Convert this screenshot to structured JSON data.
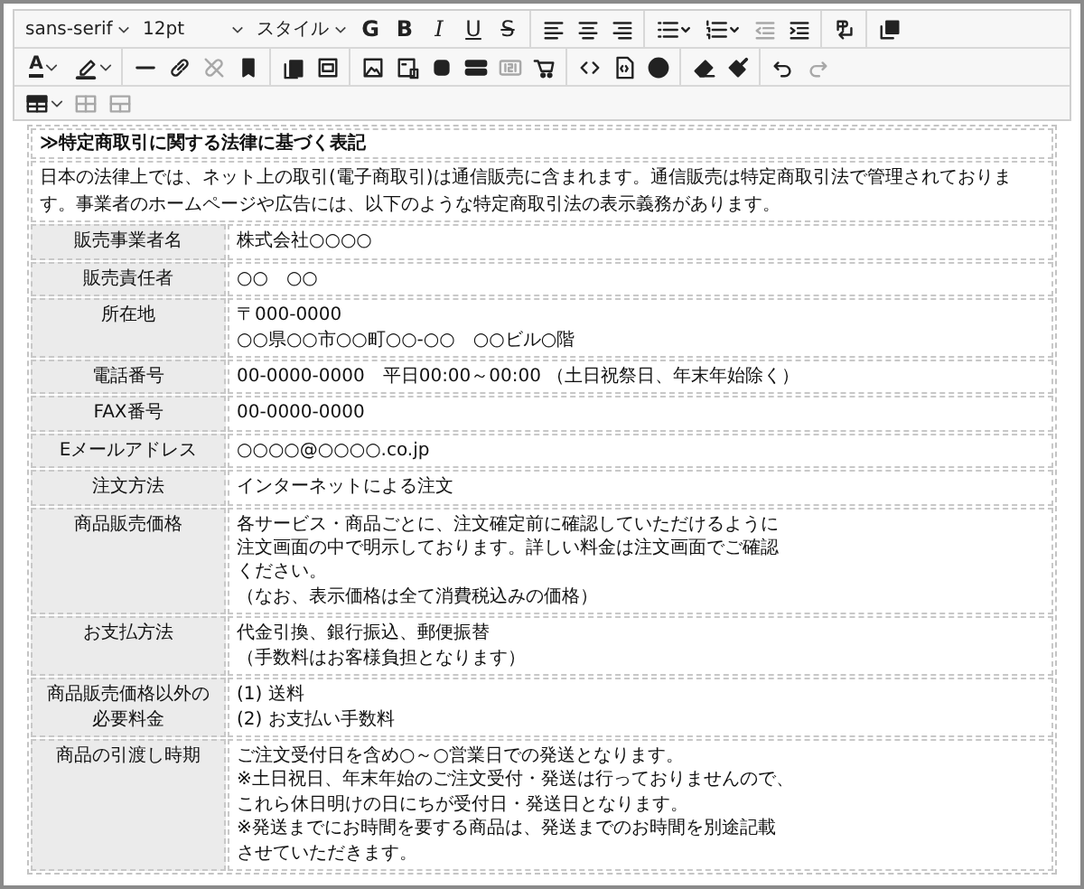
{
  "toolbar": {
    "font": "sans-serif",
    "size": "12pt",
    "style": "スタイル",
    "format_buttons": [
      {
        "label": "G",
        "kind": "plain"
      },
      {
        "label": "B",
        "kind": "bold"
      },
      {
        "label": "I",
        "kind": "italic"
      },
      {
        "label": "U",
        "kind": "underline"
      },
      {
        "label": "S",
        "kind": "strike"
      }
    ],
    "text_color_label": "A",
    "undo": {
      "disabled": false
    },
    "redo": {
      "disabled": true
    },
    "table_buttons": [
      {
        "disabled": true
      },
      {
        "disabled": true
      }
    ]
  },
  "document": {
    "title": "≫特定商取引に関する法律に基づく表記",
    "intro": "日本の法律上では、ネット上の取引(電子商取引)は通信販売に含まれます。通信販売は特定商取引法で管理されております。事業者のホームページや広告には、以下のような特定商取引法の表示義務があります。",
    "rows": [
      {
        "label": [
          "販売事業者名"
        ],
        "lines": [
          "株式会社○○○○"
        ]
      },
      {
        "label": [
          "販売責任者"
        ],
        "lines": [
          "○○　○○"
        ]
      },
      {
        "label": [
          "所在地"
        ],
        "lines": [
          "〒000-0000",
          "○○県○○市○○町○○-○○　○○ビル○階"
        ]
      },
      {
        "label": [
          "電話番号"
        ],
        "lines": [
          "00-0000-0000　平日00:00～00:00 （土日祝祭日、年末年始除く）"
        ]
      },
      {
        "label": [
          "FAX番号"
        ],
        "lines": [
          "00-0000-0000"
        ]
      },
      {
        "label": [
          "Eメールアドレス"
        ],
        "lines": [
          "○○○○@○○○○.co.jp"
        ]
      },
      {
        "label": [
          "注文方法"
        ],
        "lines": [
          "インターネットによる注文"
        ]
      },
      {
        "label": [
          "商品販売価格"
        ],
        "lines": [
          "各サービス・商品ごとに、注文確定前に確認していただけるように",
          "注文画面の中で明示しております。詳しい料金は注文画面でご確認",
          "ください。",
          "（なお、表示価格は全て消費税込みの価格）"
        ]
      },
      {
        "label": [
          "お支払方法"
        ],
        "lines": [
          "代金引換、銀行振込、郵便振替",
          "（手数料はお客様負担となります）"
        ]
      },
      {
        "label": [
          "商品販売価格以外の",
          "必要料金"
        ],
        "lines": [
          "(1) 送料",
          "(2) お支払い手数料"
        ]
      },
      {
        "label": [
          "商品の引渡し時期"
        ],
        "lines": [
          "ご注文受付日を含め○～○営業日での発送となります。",
          "※土日祝日、年末年始のご注文受付・発送は行っておりませんので、",
          "これら休日明けの日にちが受付日・発送日となります。",
          "※発送までにお時間を要する商品は、発送までのお時間を別途記載",
          "させていただきます。"
        ]
      }
    ]
  }
}
